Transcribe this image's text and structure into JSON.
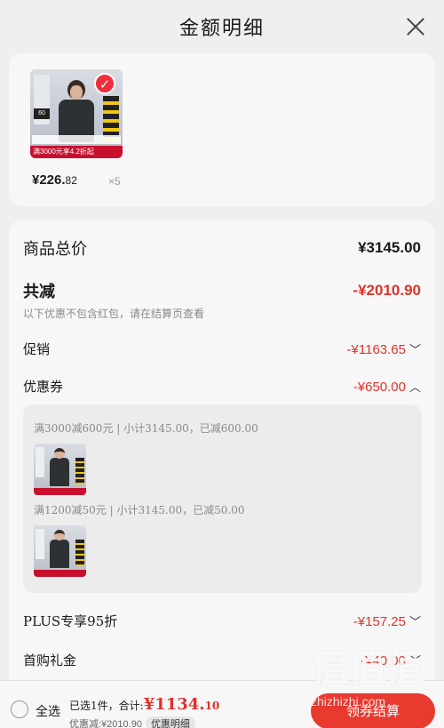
{
  "header": {
    "title": "金额明细"
  },
  "product": {
    "banner": "满3000元享4.2折起",
    "badge": "60",
    "price_int": "¥226.",
    "price_dec": "82",
    "qty": "×5"
  },
  "details": {
    "total_label": "商品总价",
    "total_value": "¥3145.00",
    "discount_label": "共减",
    "discount_value": "-¥2010.90",
    "note": "以下优惠不包含红包，请在结算页查看",
    "promo_label": "促销",
    "promo_value": "-¥1163.65",
    "coupon_label": "优惠券",
    "coupon_value": "-¥650.00",
    "coupons": [
      {
        "text": "满3000减600元 | 小计3145.00，已减600.00"
      },
      {
        "text": "满1200减50元 | 小计3145.00，已减50.00"
      }
    ],
    "plus_label": "PLUS专享95折",
    "plus_value": "-¥157.25",
    "first_label": "首购礼金",
    "first_value": "-¥40.00"
  },
  "footer": {
    "select_all": "全选",
    "summary_prefix": "已选1件，合计:",
    "total_int": "¥1134.",
    "total_dec": "10",
    "sub_text": "优惠减:¥2010.90",
    "detail_pill": "优惠明细",
    "checkout": "领券结算"
  },
  "watermark": {
    "text": "值值值",
    "url": "zhizhizhi.com"
  }
}
